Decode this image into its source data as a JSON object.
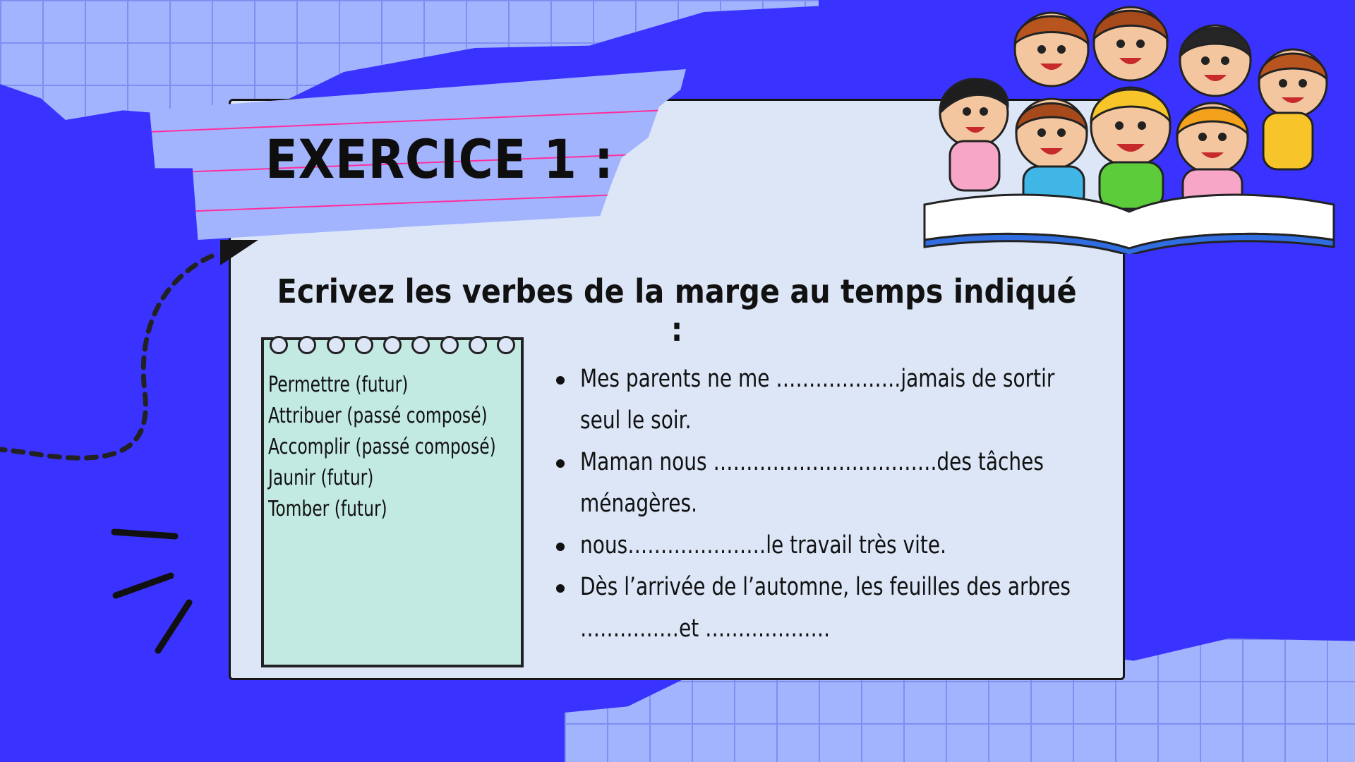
{
  "title": "EXERCICE 1 :",
  "instruction": "Ecrivez les verbes de la marge au temps indiqué :",
  "margin_verbs": [
    "Permettre (futur)",
    "Attribuer (passé composé)",
    "Accomplir (passé composé)",
    "Jaunir (futur)",
    "Tomber (futur)"
  ],
  "sentences": [
    "Mes parents ne me ……………….jamais de sortir seul le soir.",
    "Maman nous …………………………….des tâches ménagères.",
    "nous…………………le travail très vite.",
    "Dès l’arrivée de l’automne, les feuilles des arbres ……………et ………………."
  ],
  "colors": {
    "background": "#3a33ff",
    "grid_paper": "#a3b4ff",
    "card": "#dce6f7",
    "notepad": "#c2eae2",
    "tape_lines": "#ff2e9a"
  },
  "decorations": [
    "kids-reading-book-illustration",
    "dashed-curve",
    "scribble-lines"
  ]
}
